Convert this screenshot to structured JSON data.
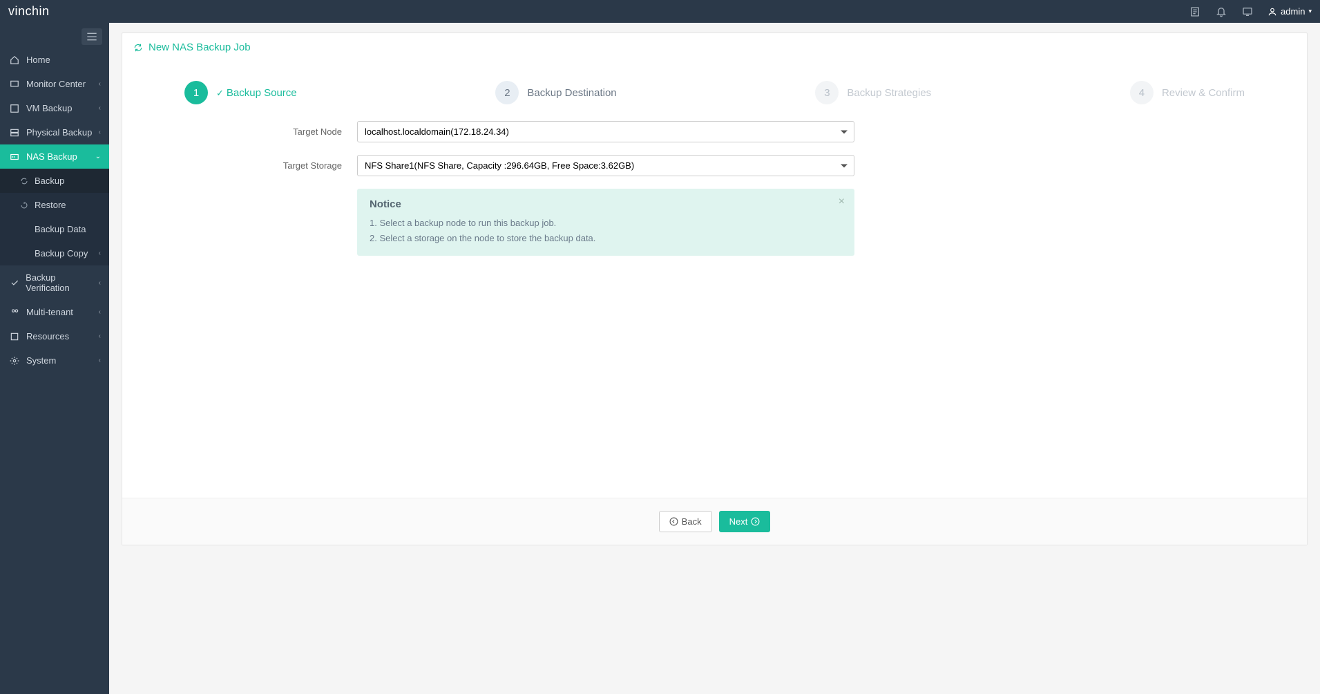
{
  "brand": "vinchin",
  "admin_label": "admin",
  "sidebar": {
    "items": [
      {
        "label": "Home"
      },
      {
        "label": "Monitor Center"
      },
      {
        "label": "VM Backup"
      },
      {
        "label": "Physical Backup"
      },
      {
        "label": "NAS Backup"
      },
      {
        "label": "Backup Verification"
      },
      {
        "label": "Multi-tenant"
      },
      {
        "label": "Resources"
      },
      {
        "label": "System"
      }
    ],
    "nas_sub": [
      {
        "label": "Backup"
      },
      {
        "label": "Restore"
      },
      {
        "label": "Backup Data"
      },
      {
        "label": "Backup Copy"
      }
    ]
  },
  "page_title": "New NAS Backup Job",
  "steps": [
    {
      "num": "1",
      "label": "Backup Source"
    },
    {
      "num": "2",
      "label": "Backup Destination"
    },
    {
      "num": "3",
      "label": "Backup Strategies"
    },
    {
      "num": "4",
      "label": "Review & Confirm"
    }
  ],
  "form": {
    "target_node_label": "Target Node",
    "target_node_value": "localhost.localdomain(172.18.24.34)",
    "target_storage_label": "Target Storage",
    "target_storage_value": "NFS Share1(NFS Share, Capacity :296.64GB, Free Space:3.62GB)"
  },
  "notice": {
    "title": "Notice",
    "line1": "1. Select a backup node to run this backup job.",
    "line2": "2. Select a storage on the node to store the backup data."
  },
  "buttons": {
    "back": "Back",
    "next": "Next"
  }
}
